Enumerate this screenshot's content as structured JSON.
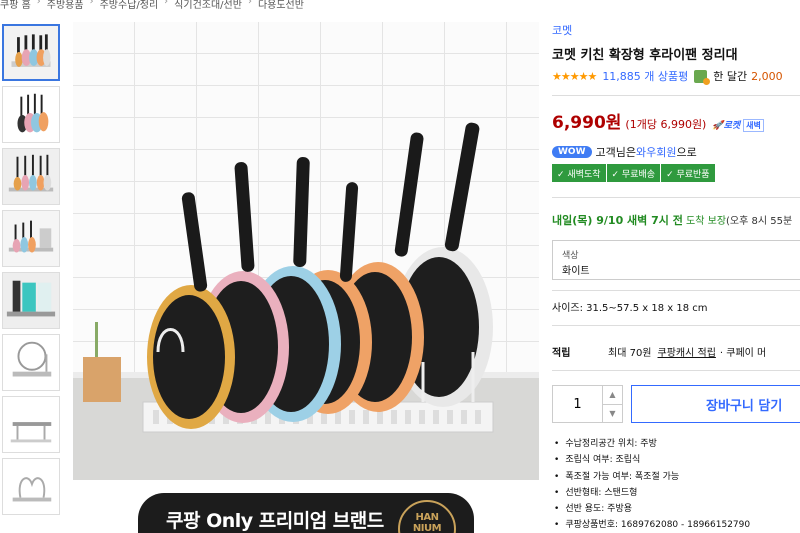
{
  "breadcrumb": [
    "쿠팡 홈",
    "주방용품",
    "주방수납/정리",
    "식기건조대/선반",
    "다용도선반"
  ],
  "thumbnails": [
    "thumb-1",
    "thumb-2",
    "thumb-3",
    "thumb-4",
    "thumb-5",
    "thumb-6",
    "thumb-7",
    "thumb-8"
  ],
  "product": {
    "brand": "코멧",
    "title": "코멧 키친 확장형 후라이팬 정리대",
    "rating_stars": "★★★★★",
    "rating_value": 4.5,
    "review_count": "11,885 개 상품평",
    "month_label": "한 달간",
    "month_count": "2,000"
  },
  "price": {
    "amount": "6,990원",
    "unit_price": "(1개당 6,990원)",
    "rocket_label": "🚀로켓",
    "dawn_label": "새벽"
  },
  "wow": {
    "badge": "WOW",
    "text_before": "고객님은 ",
    "link": "와우회원",
    "text_after": "으로"
  },
  "benefits": [
    "✓ 새벽도착",
    "✓ 무료배송",
    "✓ 무료반품"
  ],
  "delivery": {
    "date": "내일(목) 9/10 새벽 7시 전",
    "guarantee": " 도착 보장",
    "note": "(오후 8시 55분"
  },
  "option": {
    "label": "색상",
    "value": "화이트"
  },
  "size": "사이즈: 31.5~57.5 x 18 x 18 cm",
  "points": {
    "label": "적립",
    "max": "최대 70원",
    "link": "쿠팡캐시 적립",
    "rest": "· 쿠페이 머"
  },
  "quantity": {
    "value": "1",
    "up": "▲",
    "down": "▼"
  },
  "cart_button": "장바구니 담기",
  "specs": [
    "수납정리공간 위치: 주방",
    "조립식 여부: 조립식",
    "폭조절 가능 여부: 폭조절 가능",
    "선반형태: 스탠드형",
    "선반 용도: 주방용",
    "쿠팡상품번호: 1689762080 - 18966152790"
  ],
  "banner": {
    "text": "쿠팡 Only 프리미엄 브랜드",
    "logo": "HAN\nNIUM"
  },
  "colors": {
    "accent": "#346aff",
    "price": "#ae0000",
    "green": "#2f9a3e",
    "thumb_active": "#3a76e0"
  }
}
